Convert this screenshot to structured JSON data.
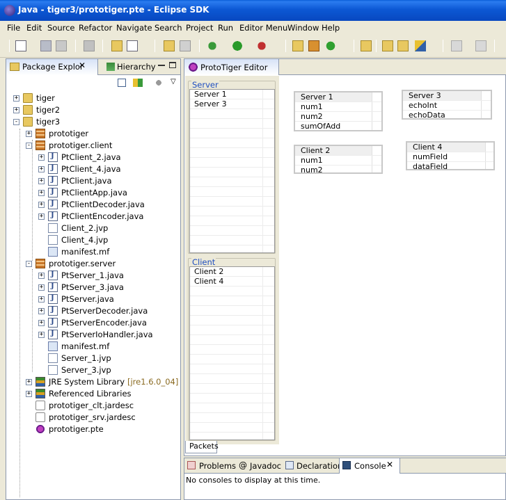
{
  "window": {
    "title": "Java - tiger3/prototiger.pte - Eclipse SDK"
  },
  "menu": [
    "File",
    "Edit",
    "Source",
    "Refactor",
    "Navigate",
    "Search",
    "Project",
    "Run",
    "Editor Menu",
    "Window",
    "Help"
  ],
  "left_view": {
    "tabs": [
      "Package Explor",
      "Hierarchy"
    ],
    "tree": [
      {
        "label": "tiger",
        "level": 0,
        "expander": "+",
        "icon": "project-folder-icon"
      },
      {
        "label": "tiger2",
        "level": 0,
        "expander": "+",
        "icon": "project-folder-icon"
      },
      {
        "label": "tiger3",
        "level": 0,
        "expander": "-",
        "icon": "project-folder-icon"
      },
      {
        "label": "prototiger",
        "level": 1,
        "expander": "+",
        "icon": "package-icon"
      },
      {
        "label": "prototiger.client",
        "level": 1,
        "expander": "-",
        "icon": "package-icon"
      },
      {
        "label": "PtClient_2.java",
        "level": 2,
        "expander": "+",
        "icon": "java-file-icon"
      },
      {
        "label": "PtClient_4.java",
        "level": 2,
        "expander": "+",
        "icon": "java-file-icon"
      },
      {
        "label": "PtClient.java",
        "level": 2,
        "expander": "+",
        "icon": "java-file-icon"
      },
      {
        "label": "PtClientApp.java",
        "level": 2,
        "expander": "+",
        "icon": "java-file-icon"
      },
      {
        "label": "PtClientDecoder.java",
        "level": 2,
        "expander": "+",
        "icon": "java-file-icon"
      },
      {
        "label": "PtClientEncoder.java",
        "level": 2,
        "expander": "+",
        "icon": "java-file-icon"
      },
      {
        "label": "Client_2.jvp",
        "level": 2,
        "expander": "",
        "icon": "file-icon"
      },
      {
        "label": "Client_4.jvp",
        "level": 2,
        "expander": "",
        "icon": "file-icon"
      },
      {
        "label": "manifest.mf",
        "level": 2,
        "expander": "",
        "icon": "manifest-icon"
      },
      {
        "label": "prototiger.server",
        "level": 1,
        "expander": "-",
        "icon": "package-icon"
      },
      {
        "label": "PtServer_1.java",
        "level": 2,
        "expander": "+",
        "icon": "java-file-icon"
      },
      {
        "label": "PtServer_3.java",
        "level": 2,
        "expander": "+",
        "icon": "java-file-icon"
      },
      {
        "label": "PtServer.java",
        "level": 2,
        "expander": "+",
        "icon": "java-file-icon"
      },
      {
        "label": "PtServerDecoder.java",
        "level": 2,
        "expander": "+",
        "icon": "java-file-icon"
      },
      {
        "label": "PtServerEncoder.java",
        "level": 2,
        "expander": "+",
        "icon": "java-file-icon"
      },
      {
        "label": "PtServerIoHandler.java",
        "level": 2,
        "expander": "+",
        "icon": "java-file-icon"
      },
      {
        "label": "manifest.mf",
        "level": 2,
        "expander": "",
        "icon": "manifest-icon"
      },
      {
        "label": "Server_1.jvp",
        "level": 2,
        "expander": "",
        "icon": "file-icon"
      },
      {
        "label": "Server_3.jvp",
        "level": 2,
        "expander": "",
        "icon": "file-icon"
      },
      {
        "label": "JRE System Library",
        "suffix": "[jre1.6.0_04]",
        "level": 1,
        "expander": "+",
        "icon": "library-icon"
      },
      {
        "label": "Referenced Libraries",
        "level": 1,
        "expander": "+",
        "icon": "library-icon"
      },
      {
        "label": "prototiger_clt.jardesc",
        "level": 1,
        "expander": "",
        "icon": "jardesc-icon"
      },
      {
        "label": "prototiger_srv.jardesc",
        "level": 1,
        "expander": "",
        "icon": "jardesc-icon"
      },
      {
        "label": "prototiger.pte",
        "level": 1,
        "expander": "",
        "icon": "pte-file-icon"
      }
    ]
  },
  "editor": {
    "tab": "ProtoTiger Editor",
    "server_group": {
      "title": "Server",
      "items": [
        "Server 1",
        "Server 3"
      ]
    },
    "client_group": {
      "title": "Client",
      "items": [
        "Client 2",
        "Client 4"
      ]
    },
    "nodes": [
      {
        "title": "Server 1",
        "fields": [
          "num1",
          "num2",
          "sumOfAdd"
        ]
      },
      {
        "title": "Server 3",
        "fields": [
          "echoInt",
          "echoData"
        ]
      },
      {
        "title": "Client 2",
        "fields": [
          "num1",
          "num2"
        ]
      },
      {
        "title": "Client 4",
        "fields": [
          "numField",
          "dataField"
        ]
      }
    ],
    "bottom_tab": "Packets"
  },
  "bottom_view": {
    "tabs": [
      "Problems",
      "Javadoc",
      "Declaration",
      "Console"
    ],
    "message": "No consoles to display at this time."
  }
}
